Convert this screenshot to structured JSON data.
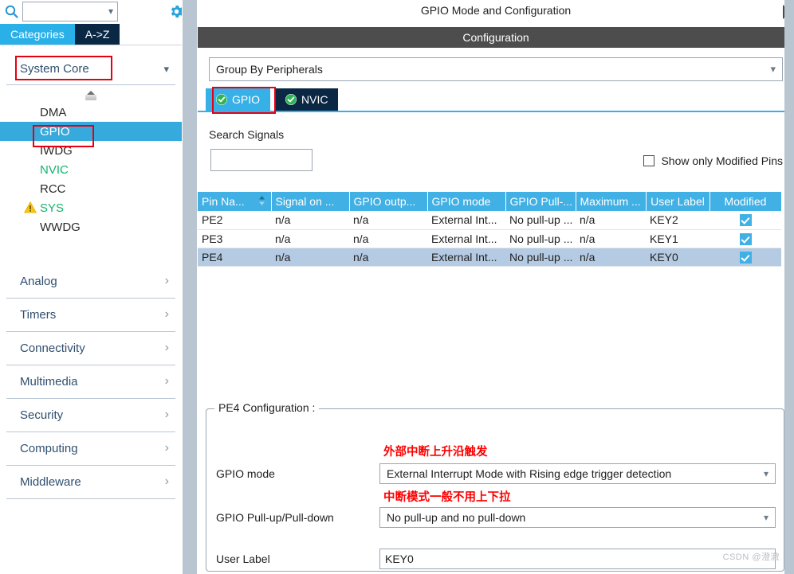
{
  "sidebar": {
    "search": {
      "placeholder": "",
      "value": "",
      "icon": "search-icon"
    },
    "gear_icon": "gear-icon",
    "tabs": [
      {
        "label": "Categories",
        "selected": true
      },
      {
        "label": "A->Z",
        "selected": false
      }
    ],
    "group": {
      "title": "System Core",
      "expanded": true,
      "highlight_color": "#e60012"
    },
    "peripherals": [
      {
        "label": "DMA",
        "state": "normal",
        "selected": false
      },
      {
        "label": "GPIO",
        "state": "normal",
        "selected": true
      },
      {
        "label": "IWDG",
        "state": "normal",
        "selected": false
      },
      {
        "label": "NVIC",
        "state": "ok",
        "selected": false
      },
      {
        "label": "RCC",
        "state": "normal",
        "selected": false
      },
      {
        "label": "SYS",
        "state": "warning",
        "selected": false
      },
      {
        "label": "WWDG",
        "state": "normal",
        "selected": false
      }
    ],
    "categories": [
      {
        "label": "Analog"
      },
      {
        "label": "Timers"
      },
      {
        "label": "Connectivity"
      },
      {
        "label": "Multimedia"
      },
      {
        "label": "Security"
      },
      {
        "label": "Computing"
      },
      {
        "label": "Middleware"
      }
    ]
  },
  "main": {
    "mode_title": "GPIO Mode and Configuration",
    "configuration_bar": "Configuration",
    "group_by": {
      "value": "Group By Peripherals"
    },
    "peripheral_tabs": [
      {
        "label": "GPIO",
        "active": true,
        "status_icon": "check-circle-icon"
      },
      {
        "label": "NVIC",
        "active": false,
        "status_icon": "check-circle-icon"
      }
    ],
    "search_signals": {
      "label": "Search Signals",
      "value": "",
      "placeholder": ""
    },
    "show_only_modified": {
      "label": "Show only Modified Pins",
      "checked": false
    },
    "table": {
      "columns": [
        "Pin Na...",
        "Signal on ...",
        "GPIO outp...",
        "GPIO mode",
        "GPIO Pull-...",
        "Maximum ...",
        "User Label",
        "Modified"
      ],
      "sort_column": "Pin Na...",
      "rows": [
        {
          "pin": "PE2",
          "signal": "n/a",
          "output": "n/a",
          "mode": "External Int...",
          "pull": "No pull-up ...",
          "maximum": "n/a",
          "user_label": "KEY2",
          "modified": true,
          "selected": false
        },
        {
          "pin": "PE3",
          "signal": "n/a",
          "output": "n/a",
          "mode": "External Int...",
          "pull": "No pull-up ...",
          "maximum": "n/a",
          "user_label": "KEY1",
          "modified": true,
          "selected": false
        },
        {
          "pin": "PE4",
          "signal": "n/a",
          "output": "n/a",
          "mode": "External Int...",
          "pull": "No pull-up ...",
          "maximum": "n/a",
          "user_label": "KEY0",
          "modified": true,
          "selected": true
        }
      ]
    },
    "pin_config": {
      "title": "PE4 Configuration :",
      "gpio_mode": {
        "label": "GPIO mode",
        "value": "External Interrupt Mode with Rising edge trigger detection"
      },
      "gpio_pull": {
        "label": "GPIO Pull-up/Pull-down",
        "value": "No pull-up and no pull-down"
      },
      "user_label": {
        "label": "User Label",
        "value": "KEY0"
      },
      "annotations": [
        {
          "text": "外部中断上升沿触发",
          "color": "#ff0000"
        },
        {
          "text": "中断模式一般不用上下拉",
          "color": "#ff0000"
        }
      ]
    },
    "watermark": "CSDN @澄澈"
  }
}
